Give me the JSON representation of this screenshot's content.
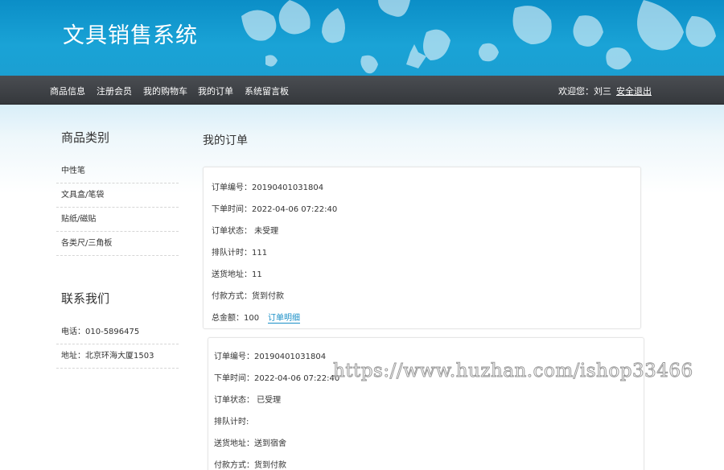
{
  "header": {
    "site_title": "文具销售系统"
  },
  "nav": {
    "items": [
      "商品信息",
      "注册会员",
      "我的购物车",
      "我的订单",
      "系统留言板"
    ],
    "welcome": "欢迎您：刘三",
    "logout": "安全退出"
  },
  "sidebar": {
    "category_heading": "商品类别",
    "categories": [
      "中性笔",
      "文具盒/笔袋",
      "贴纸/磁贴",
      "各类尺/三角板"
    ],
    "contact_heading": "联系我们",
    "contact": [
      "电话：010-5896475",
      "地址：北京环海大厦1503"
    ]
  },
  "main": {
    "title": "我的订单",
    "orders": [
      {
        "order_no": "订单编号：20190401031804",
        "order_time": "下单时间：2022-04-06 07:22:40",
        "status": "订单状态： 未受理",
        "queue": "排队计时：111",
        "address": "送货地址：11",
        "payment": "付款方式：货到付款",
        "total": "总金额：100",
        "detail_link": "订单明细"
      },
      {
        "order_no": "订单编号：20190401031804",
        "order_time": "下单时间：2022-04-06 07:22:40",
        "status": "订单状态： 已受理",
        "queue": "排队计时:",
        "address": "送货地址：送到宿舍",
        "payment": "付款方式：货到付款"
      }
    ]
  },
  "watermark": "https://www.huzhan.com/ishop33466"
}
